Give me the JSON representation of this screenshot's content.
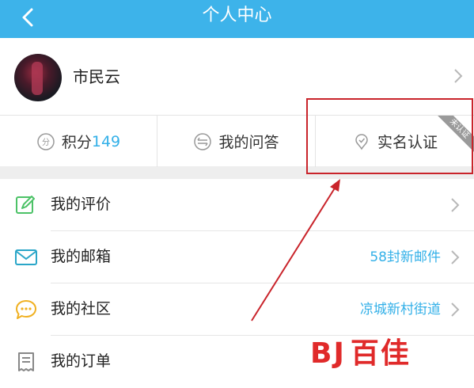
{
  "nav": {
    "title": "个人中心"
  },
  "profile": {
    "name": "市民云"
  },
  "stats": {
    "points_label": "积分",
    "points_value": "149",
    "qa_label": "我的问答",
    "verify_label": "实名认证",
    "verify_badge": "未认证"
  },
  "menu": [
    {
      "label": "我的评价",
      "value": "",
      "icon": "edit-icon",
      "color": "#4cc267"
    },
    {
      "label": "我的邮箱",
      "value": "58封新邮件",
      "icon": "mail-icon",
      "color": "#2aa6c8"
    },
    {
      "label": "我的社区",
      "value": "凉城新村街道",
      "icon": "chat-bubble-icon",
      "color": "#f0b020"
    },
    {
      "label": "我的订单",
      "value": "",
      "icon": "receipt-icon",
      "color": "#888888"
    }
  ],
  "watermark": {
    "mark": "BJ",
    "text": "百佳"
  },
  "colors": {
    "nav": "#3db3ea",
    "accent": "#33b0e8",
    "annotation": "#c9242b"
  }
}
